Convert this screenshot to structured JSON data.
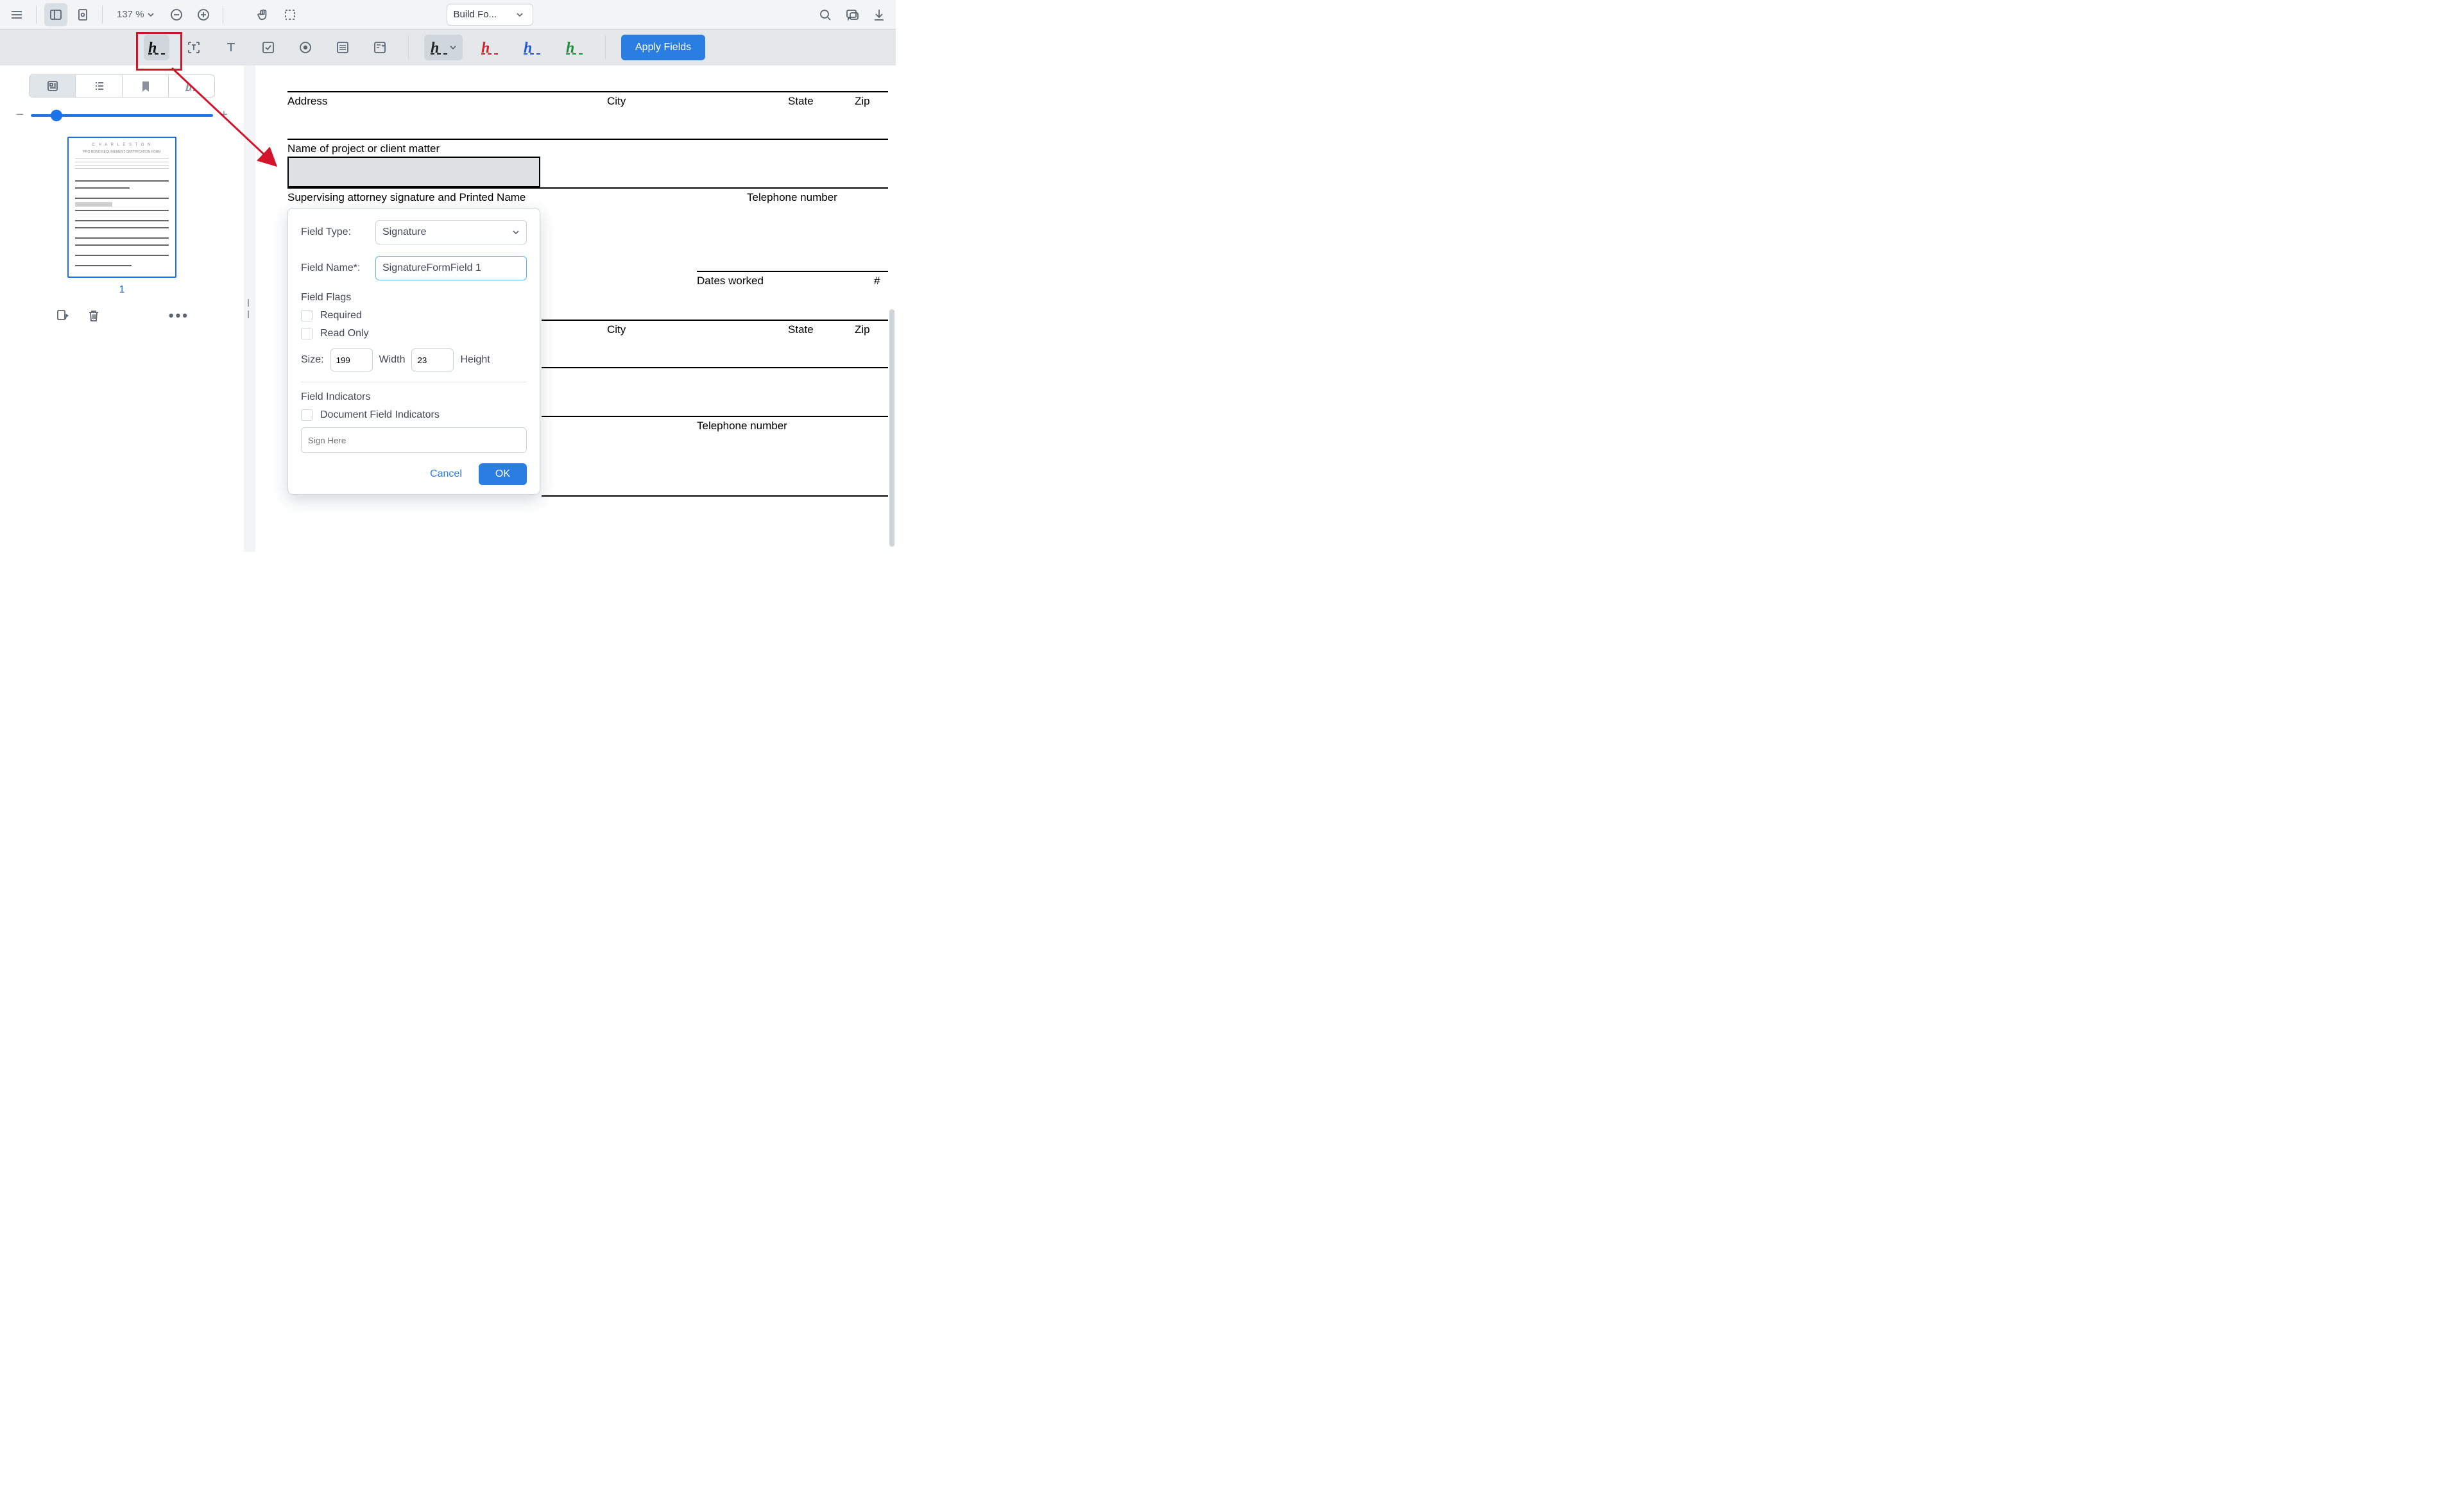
{
  "toolbar": {
    "zoom_value": "137 %",
    "mode_selected": "Build Fo..."
  },
  "form_toolbar": {
    "apply_label": "Apply Fields"
  },
  "thumbnails": {
    "page_number": "1"
  },
  "document": {
    "address_label": "Address",
    "city_label": "City",
    "state_label": "State",
    "zip_label": "Zip",
    "project_label": "Name of project or client matter",
    "supervising_prefix": "Supervising attorney signature ",
    "and_text": "and",
    "printed_name": " Printed Name",
    "telephone_label": "Telephone number",
    "dates_worked_label": "Dates worked",
    "hash_label": "#"
  },
  "popup": {
    "field_type_label": "Field Type:",
    "field_type_value": "Signature",
    "field_name_label": "Field Name*:",
    "field_name_value": "SignatureFormField 1",
    "field_flags_label": "Field Flags",
    "flag_required": "Required",
    "flag_readonly": "Read Only",
    "size_label": "Size:",
    "width_value": "199",
    "width_label": "Width",
    "height_value": "23",
    "height_label": "Height",
    "indicators_label": "Field Indicators",
    "doc_indicators_label": "Document Field Indicators",
    "indicator_placeholder": "Sign Here",
    "cancel_label": "Cancel",
    "ok_label": "OK"
  }
}
